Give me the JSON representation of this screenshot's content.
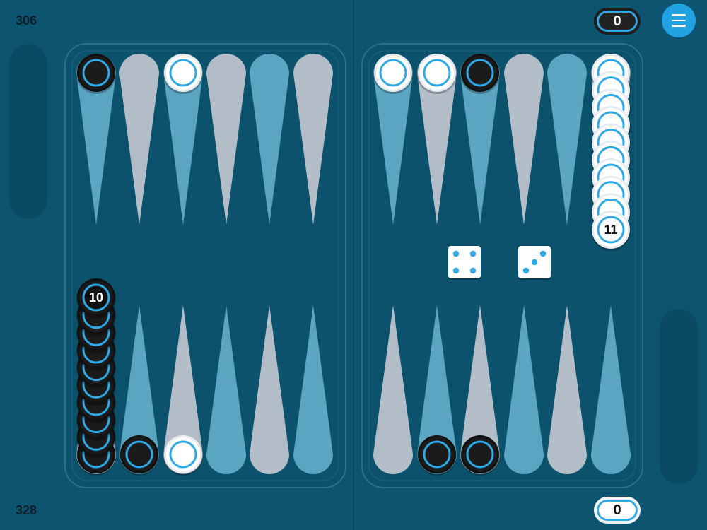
{
  "scores": {
    "top": "306",
    "bottom": "328"
  },
  "counters": {
    "top": "0",
    "bottom": "0"
  },
  "menu": {
    "icon": "hamburger-menu-icon"
  },
  "colors": {
    "background": "#0d5470",
    "board": "#0c526d",
    "triangle_light": "#b3bdc8",
    "triangle_blue": "#5aa6c2",
    "checker_black": "#1b1b1b",
    "checker_white": "#ffffff",
    "ring": "#2fa8e6",
    "accent": "#21a3e3"
  },
  "dice": {
    "die1": 4,
    "die2": 3
  },
  "checkers": {
    "white_stack_label": "11",
    "black_stack_label": "10"
  },
  "stacks": {
    "left_top": [
      {
        "color": "black",
        "count": 1
      },
      null,
      {
        "color": "white",
        "count": 1
      },
      null,
      null,
      null
    ],
    "right_top": [
      {
        "color": "white",
        "count": 1
      },
      {
        "color": "white",
        "count": 1
      },
      {
        "color": "black",
        "count": 1
      },
      null,
      null,
      {
        "color": "white",
        "count": 11
      }
    ],
    "left_bottom": [
      {
        "color": "black",
        "count": 10
      },
      {
        "color": "black",
        "count": 1
      },
      {
        "color": "white",
        "count": 1
      },
      null,
      null,
      null
    ],
    "right_bottom": [
      null,
      {
        "color": "black",
        "count": 1
      },
      {
        "color": "black",
        "count": 1
      },
      null,
      null,
      null
    ]
  }
}
